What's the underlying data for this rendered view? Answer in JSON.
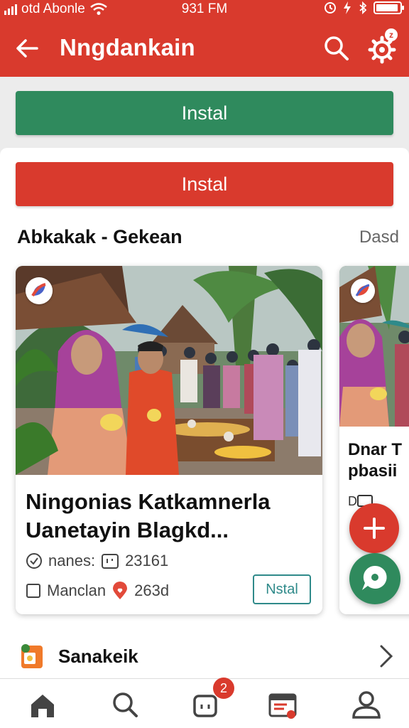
{
  "status": {
    "carrier": "otd Abonle",
    "time": "931 FM",
    "battery_level": 0.95
  },
  "appbar": {
    "title": "Nngdankain"
  },
  "buttons": {
    "green": "Instal",
    "red": "Instal"
  },
  "section": {
    "title": "Abkakak - Gekean",
    "more": "Dasd"
  },
  "card": {
    "title": "Ningonias Katkamnerla Uanetayin Blagkd...",
    "meta1_label": "nanes:",
    "meta1_value": "23161",
    "meta2_label": "Manclan",
    "meta2_value": "263d",
    "install_label": "Nstal"
  },
  "card2": {
    "title": "Dnar T pbasii"
  },
  "row": {
    "label": "Sanakeik"
  },
  "nav": {
    "badge_count": "2"
  },
  "colors": {
    "primary_red": "#d93a2d",
    "green": "#2f8a5d",
    "teal": "#2f8a8a"
  },
  "icons": [
    "back-arrow-icon",
    "search-icon",
    "gear-icon",
    "home-icon",
    "calendar-icon",
    "plus-icon",
    "chat-icon"
  ]
}
